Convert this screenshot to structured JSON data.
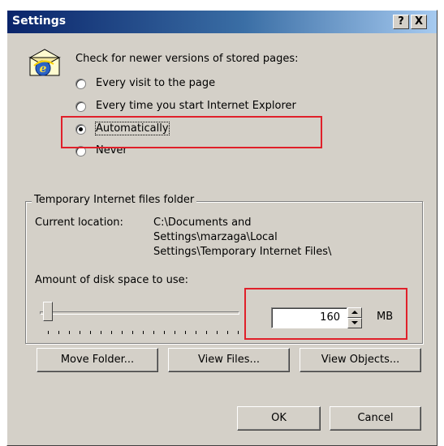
{
  "window": {
    "title": "Settings",
    "help_label": "?",
    "close_label": "X"
  },
  "check": {
    "prompt": "Check for newer versions of stored pages:",
    "options": [
      {
        "label": "Every visit to the page",
        "selected": false
      },
      {
        "label": "Every time you start Internet Explorer",
        "selected": false
      },
      {
        "label": "Automatically",
        "selected": true
      },
      {
        "label": "Never",
        "selected": false
      }
    ]
  },
  "temp_files": {
    "group_title": "Temporary Internet files folder",
    "location_label": "Current location:",
    "location_lines": [
      "C:\\Documents and",
      "Settings\\marzaga\\Local",
      "Settings\\Temporary Internet Files\\"
    ],
    "disk_space_label": "Amount of disk space to use:",
    "disk_space_value": "160",
    "disk_space_unit": "MB",
    "buttons": {
      "move_folder": "Move Folder...",
      "view_files": "View Files...",
      "view_objects": "View Objects..."
    }
  },
  "footer": {
    "ok_label": "OK",
    "cancel_label": "Cancel"
  },
  "colors": {
    "highlight": "#e0202a",
    "dialog_face": "#d4d0c8",
    "title_start": "#0a246a",
    "title_end": "#a6caf0"
  },
  "icons": {
    "app": "internet-explorer-folder-icon"
  }
}
